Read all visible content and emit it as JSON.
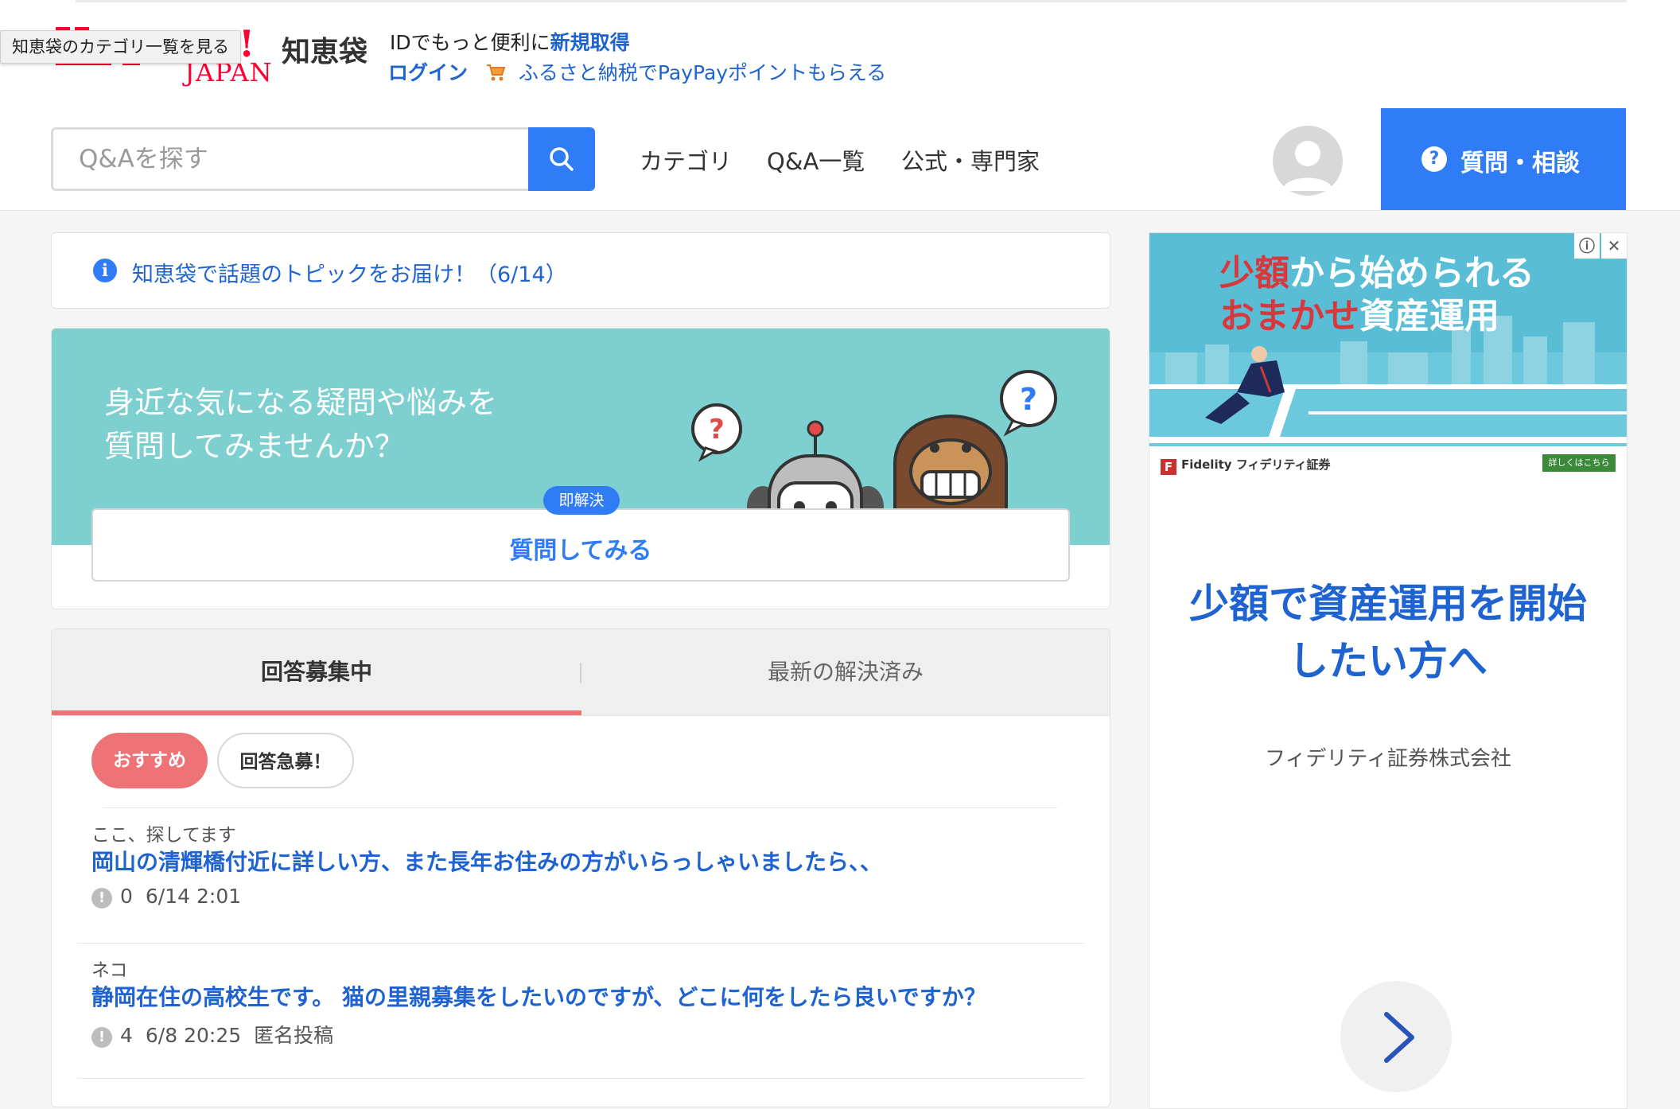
{
  "header": {
    "tooltip": "知恵袋のカテゴリ一覧を見る",
    "logo_japan": "JAPAN",
    "logo_excl": "!",
    "logo_chiebukuro": "知恵袋",
    "promo_line1_prefix": "IDでもっと便利に",
    "promo_line1_link": "新規取得",
    "login": "ログイン",
    "furusato": "ふるさと納税でPayPayポイントもらえる"
  },
  "nav": {
    "search_placeholder": "Q&Aを探す",
    "links": [
      "カテゴリ",
      "Q&A一覧",
      "公式・専門家"
    ],
    "ask_button": "質問・相談"
  },
  "notice": {
    "text": "知恵袋で話題のトピックをお届け！（6/14）"
  },
  "hero": {
    "text": "身近な気になる疑問や悩みを\n質問してみませんか？",
    "badge": "即解決",
    "button": "質問してみる"
  },
  "qa": {
    "tabs": [
      "回答募集中",
      "最新の解決済み"
    ],
    "chips": [
      "おすすめ",
      "回答急募！"
    ],
    "items": [
      {
        "category": "ここ、探してます",
        "title": "岡山の清輝橋付近に詳しい方、また長年お住みの方がいらっしゃいましたら、、",
        "answers": "0",
        "date": "6/14 2:01",
        "extra": ""
      },
      {
        "category": "ネコ",
        "title": "静岡在住の高校生です。 猫の里親募集をしたいのですが、どこに何をしたら良いですか？",
        "answers": "4",
        "date": "6/8 20:25",
        "extra": "匿名投稿"
      }
    ]
  },
  "ad": {
    "headline_red1": "少額",
    "headline_rest1": "から始められる",
    "headline_red2": "おまかせ",
    "headline_rest2": "資産運用",
    "brand": "Fidelity フィデリティ証券",
    "cta_small": "詳しくはこちら",
    "title": "少額で資産運用を開始\nしたい方へ",
    "company": "フィデリティ証券株式会社"
  },
  "colors": {
    "accent_blue": "#2f7cf6",
    "link_blue": "#1e63d0",
    "pink": "#ee7376",
    "teal": "#7ecfcf",
    "yahoo_red": "#ff0033"
  }
}
